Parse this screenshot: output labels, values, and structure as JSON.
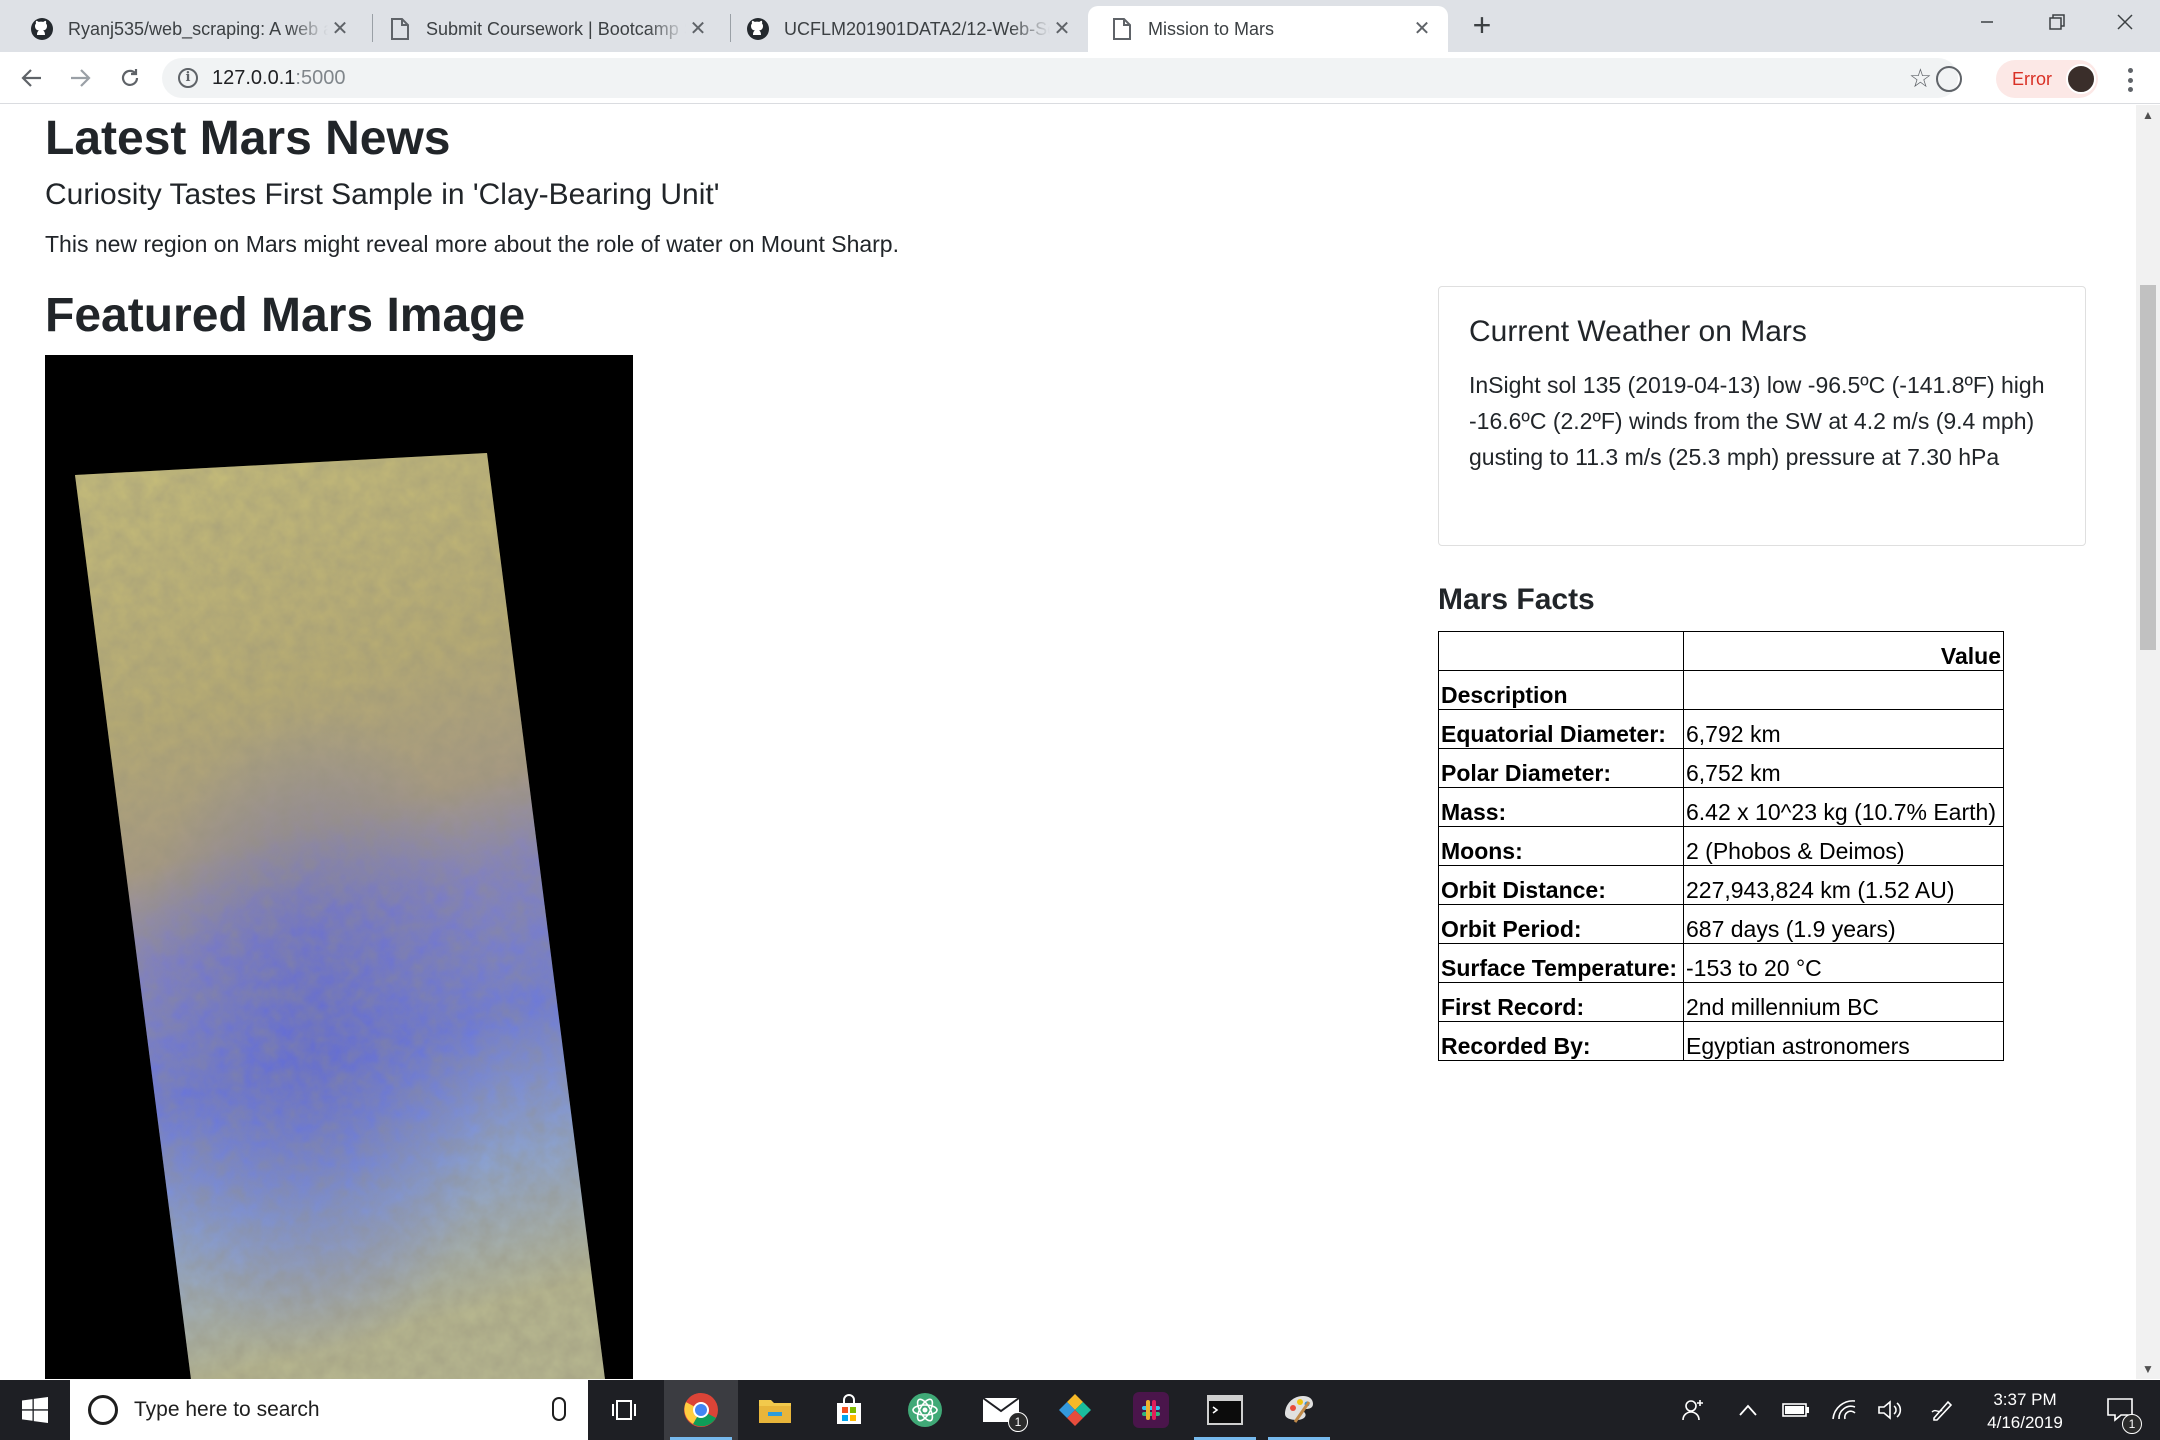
{
  "browser": {
    "tabs": [
      {
        "title": "Ryanj535/web_scraping: A web application that scrapes",
        "icon": "github-icon",
        "active": false
      },
      {
        "title": "Submit Coursework | Bootcamp Spot",
        "icon": "page-icon",
        "active": false
      },
      {
        "title": "UCFLM201901DATA2/12-Web-Scraping",
        "icon": "github-icon",
        "active": false
      },
      {
        "title": "Mission to Mars",
        "icon": "page-icon",
        "active": true
      }
    ],
    "url_host": "127.0.0.1",
    "url_port": ":5000",
    "profile_status": "Error"
  },
  "page": {
    "news_heading": "Latest Mars News",
    "news_title": "Curiosity Tastes First Sample in 'Clay-Bearing Unit'",
    "news_paragraph": "This new region on Mars might reveal more about the role of water on Mount Sharp.",
    "featured_heading": "Featured Mars Image",
    "weather_heading": "Current Weather on Mars",
    "weather_text": "InSight sol 135 (2019-04-13) low -96.5ºC (-141.8ºF) high -16.6ºC (2.2ºF) winds from the SW at 4.2 m/s (9.4 mph) gusting to 11.3 m/s (25.3 mph) pressure at 7.30 hPa",
    "facts_heading": "Mars Facts",
    "facts_table": {
      "header_value": "Value",
      "index_label": "Description",
      "rows": [
        {
          "label": "Equatorial Diameter:",
          "value": "6,792 km"
        },
        {
          "label": "Polar Diameter:",
          "value": "6,752 km"
        },
        {
          "label": "Mass:",
          "value": "6.42 x 10^23 kg (10.7% Earth)"
        },
        {
          "label": "Moons:",
          "value": "2 (Phobos & Deimos)"
        },
        {
          "label": "Orbit Distance:",
          "value": "227,943,824 km (1.52 AU)"
        },
        {
          "label": "Orbit Period:",
          "value": "687 days (1.9 years)"
        },
        {
          "label": "Surface Temperature:",
          "value": "-153 to 20 °C"
        },
        {
          "label": "First Record:",
          "value": "2nd millennium BC"
        },
        {
          "label": "Recorded By:",
          "value": "Egyptian astronomers"
        }
      ]
    }
  },
  "taskbar": {
    "search_placeholder": "Type here to search",
    "time": "3:37 PM",
    "date": "4/16/2019",
    "mail_badge": "1",
    "notification_badge": "1",
    "apps": [
      "chrome-icon",
      "file-explorer-icon",
      "store-icon",
      "atom-icon",
      "mail-icon",
      "gitkraken-icon",
      "slack-icon",
      "terminal-icon",
      "paint-icon"
    ]
  },
  "colors": {
    "tabstrip": "#dee1e6",
    "taskbar": "#1e1f24",
    "error_chip_bg": "#fce8e6",
    "error_text": "#d93025"
  }
}
